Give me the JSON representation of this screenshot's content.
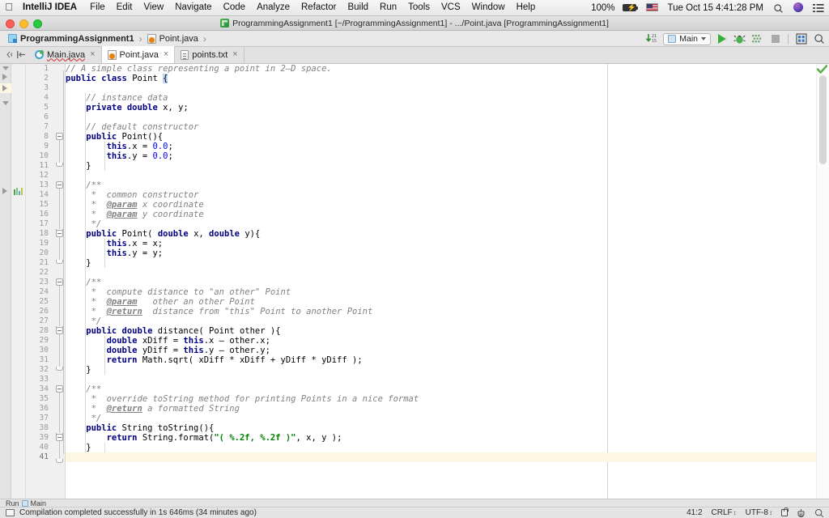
{
  "menubar": {
    "apple_icon": "apple-logo-icon",
    "app_name": "IntelliJ IDEA",
    "items": [
      "File",
      "Edit",
      "View",
      "Navigate",
      "Code",
      "Analyze",
      "Refactor",
      "Build",
      "Run",
      "Tools",
      "VCS",
      "Window",
      "Help"
    ],
    "battery_percent": "100%",
    "battery_icon": "battery-charging-icon",
    "input_source": "us-flag-icon",
    "clock": "Tue Oct 15  4:41:28 PM",
    "spotlight_icon": "search-icon",
    "siri_icon": "siri-icon",
    "control_center_icon": "list-menu-icon"
  },
  "titlebar": {
    "project_icon": "project-icon",
    "text": "ProgrammingAssignment1 [~/ProgrammingAssignment1] - .../Point.java [ProgrammingAssignment1]",
    "close_label": "close-window",
    "minimize_label": "minimize-window",
    "zoom_label": "zoom-window"
  },
  "navbar": {
    "breadcrumbs": [
      {
        "icon": "module-icon",
        "label": "ProgrammingAssignment1",
        "bold": true
      },
      {
        "icon": "java-file-icon",
        "label": "Point.java",
        "bold": false
      }
    ],
    "separator": "›",
    "update_icon": "update-project-icon",
    "run_config": {
      "icon": "run-config-icon",
      "label": "Main",
      "caret": "chevron-down-icon"
    },
    "run_icon": "run-icon",
    "debug_icon": "debug-icon",
    "coverage_icon": "run-with-coverage-icon",
    "stop_icon": "stop-icon",
    "layout_icon": "select-target-icon",
    "search_icon": "search-everywhere-icon"
  },
  "tabs": {
    "back_icon": "back-icon",
    "align_icon": "align-left-icon",
    "items": [
      {
        "icon": "class-icon",
        "label": "Main.java",
        "active": false,
        "error": true,
        "close": "×"
      },
      {
        "icon": "java-file-icon",
        "label": "Point.java",
        "active": true,
        "error": false,
        "close": "×"
      },
      {
        "icon": "text-file-icon",
        "label": "points.txt",
        "active": false,
        "error": false,
        "close": "×"
      }
    ]
  },
  "editor": {
    "inspection_icon": "inspections-ok-checkmark",
    "scrollbar": "vertical-scrollbar",
    "current_line": 41,
    "first_line": 1,
    "lines": [
      {
        "n": 1,
        "tokens": [
          {
            "t": "// A simple class representing a point in 2–D space.",
            "c": "cm"
          }
        ]
      },
      {
        "n": 2,
        "tokens": [
          {
            "t": "public class ",
            "c": "kw"
          },
          {
            "t": "Point ",
            "c": "pln"
          },
          {
            "t": "{",
            "c": "sel"
          }
        ]
      },
      {
        "n": 3,
        "tokens": []
      },
      {
        "n": 4,
        "tokens": [
          {
            "t": "    // instance data",
            "c": "cm"
          }
        ]
      },
      {
        "n": 5,
        "tokens": [
          {
            "t": "    private double ",
            "c": "kw"
          },
          {
            "t": "x, y;",
            "c": "pln"
          }
        ]
      },
      {
        "n": 6,
        "tokens": []
      },
      {
        "n": 7,
        "tokens": [
          {
            "t": "    // default constructor",
            "c": "cm"
          }
        ]
      },
      {
        "n": 8,
        "tokens": [
          {
            "t": "    public ",
            "c": "kw"
          },
          {
            "t": "Point(){",
            "c": "pln"
          }
        ]
      },
      {
        "n": 9,
        "tokens": [
          {
            "t": "        ",
            "c": "pln"
          },
          {
            "t": "this",
            "c": "kw"
          },
          {
            "t": ".x = ",
            "c": "pln"
          },
          {
            "t": "0.0",
            "c": "num"
          },
          {
            "t": ";",
            "c": "pln"
          }
        ]
      },
      {
        "n": 10,
        "tokens": [
          {
            "t": "        ",
            "c": "pln"
          },
          {
            "t": "this",
            "c": "kw"
          },
          {
            "t": ".y = ",
            "c": "pln"
          },
          {
            "t": "0.0",
            "c": "num"
          },
          {
            "t": ";",
            "c": "pln"
          }
        ]
      },
      {
        "n": 11,
        "tokens": [
          {
            "t": "    }",
            "c": "pln"
          }
        ]
      },
      {
        "n": 12,
        "tokens": []
      },
      {
        "n": 13,
        "tokens": [
          {
            "t": "    /**",
            "c": "doc"
          }
        ]
      },
      {
        "n": 14,
        "tokens": [
          {
            "t": "     *  common constructor",
            "c": "doc"
          }
        ]
      },
      {
        "n": 15,
        "tokens": [
          {
            "t": "     *  ",
            "c": "doc"
          },
          {
            "t": "@param",
            "c": "tag"
          },
          {
            "t": " x coordinate",
            "c": "doc"
          }
        ]
      },
      {
        "n": 16,
        "tokens": [
          {
            "t": "     *  ",
            "c": "doc"
          },
          {
            "t": "@param",
            "c": "tag"
          },
          {
            "t": " y coordinate",
            "c": "doc"
          }
        ]
      },
      {
        "n": 17,
        "tokens": [
          {
            "t": "     */",
            "c": "doc"
          }
        ]
      },
      {
        "n": 18,
        "tokens": [
          {
            "t": "    public ",
            "c": "kw"
          },
          {
            "t": "Point( ",
            "c": "pln"
          },
          {
            "t": "double ",
            "c": "kw"
          },
          {
            "t": "x, ",
            "c": "pln"
          },
          {
            "t": "double ",
            "c": "kw"
          },
          {
            "t": "y){",
            "c": "pln"
          }
        ]
      },
      {
        "n": 19,
        "tokens": [
          {
            "t": "        ",
            "c": "pln"
          },
          {
            "t": "this",
            "c": "kw"
          },
          {
            "t": ".x = x;",
            "c": "pln"
          }
        ]
      },
      {
        "n": 20,
        "tokens": [
          {
            "t": "        ",
            "c": "pln"
          },
          {
            "t": "this",
            "c": "kw"
          },
          {
            "t": ".y = y;",
            "c": "pln"
          }
        ]
      },
      {
        "n": 21,
        "tokens": [
          {
            "t": "    }",
            "c": "pln"
          }
        ]
      },
      {
        "n": 22,
        "tokens": []
      },
      {
        "n": 23,
        "tokens": [
          {
            "t": "    /**",
            "c": "doc"
          }
        ]
      },
      {
        "n": 24,
        "tokens": [
          {
            "t": "     *  compute distance to \"an other\" Point",
            "c": "doc"
          }
        ]
      },
      {
        "n": 25,
        "tokens": [
          {
            "t": "     *  ",
            "c": "doc"
          },
          {
            "t": "@param",
            "c": "tag"
          },
          {
            "t": "   other an other Point",
            "c": "doc"
          }
        ]
      },
      {
        "n": 26,
        "tokens": [
          {
            "t": "     *  ",
            "c": "doc"
          },
          {
            "t": "@return",
            "c": "tag"
          },
          {
            "t": "  distance from \"this\" Point to another Point",
            "c": "doc"
          }
        ]
      },
      {
        "n": 27,
        "tokens": [
          {
            "t": "     */",
            "c": "doc"
          }
        ]
      },
      {
        "n": 28,
        "tokens": [
          {
            "t": "    public double ",
            "c": "kw"
          },
          {
            "t": "distance( Point other ){",
            "c": "pln"
          }
        ]
      },
      {
        "n": 29,
        "tokens": [
          {
            "t": "        ",
            "c": "pln"
          },
          {
            "t": "double ",
            "c": "kw"
          },
          {
            "t": "xDiff = ",
            "c": "pln"
          },
          {
            "t": "this",
            "c": "kw"
          },
          {
            "t": ".x – other.x;",
            "c": "pln"
          }
        ]
      },
      {
        "n": 30,
        "tokens": [
          {
            "t": "        ",
            "c": "pln"
          },
          {
            "t": "double ",
            "c": "kw"
          },
          {
            "t": "yDiff = ",
            "c": "pln"
          },
          {
            "t": "this",
            "c": "kw"
          },
          {
            "t": ".y – other.y;",
            "c": "pln"
          }
        ]
      },
      {
        "n": 31,
        "tokens": [
          {
            "t": "        ",
            "c": "pln"
          },
          {
            "t": "return ",
            "c": "kw"
          },
          {
            "t": "Math.sqrt( xDiff * xDiff + yDiff * yDiff );",
            "c": "pln"
          }
        ]
      },
      {
        "n": 32,
        "tokens": [
          {
            "t": "    }",
            "c": "pln"
          }
        ]
      },
      {
        "n": 33,
        "tokens": []
      },
      {
        "n": 34,
        "tokens": [
          {
            "t": "    /**",
            "c": "doc"
          }
        ]
      },
      {
        "n": 35,
        "tokens": [
          {
            "t": "     *  override toString method for printing Points in a nice format",
            "c": "doc"
          }
        ]
      },
      {
        "n": 36,
        "tokens": [
          {
            "t": "     *  ",
            "c": "doc"
          },
          {
            "t": "@return",
            "c": "tag"
          },
          {
            "t": " a formatted String",
            "c": "doc"
          }
        ]
      },
      {
        "n": 37,
        "tokens": [
          {
            "t": "     */",
            "c": "doc"
          }
        ]
      },
      {
        "n": 38,
        "tokens": [
          {
            "t": "    public ",
            "c": "kw"
          },
          {
            "t": "String toString(){",
            "c": "pln"
          }
        ]
      },
      {
        "n": 39,
        "tokens": [
          {
            "t": "        ",
            "c": "pln"
          },
          {
            "t": "return ",
            "c": "kw"
          },
          {
            "t": "String.format(",
            "c": "pln"
          },
          {
            "t": "\"( %.2f, %.2f )\"",
            "c": "str"
          },
          {
            "t": ", x, y );",
            "c": "pln"
          }
        ]
      },
      {
        "n": 40,
        "tokens": [
          {
            "t": "    }",
            "c": "pln"
          }
        ]
      },
      {
        "n": 41,
        "tokens": [
          {
            "t": "}",
            "c": "sel"
          }
        ]
      }
    ]
  },
  "toolstrip": {
    "run_label": "Run",
    "run_config_icon": "run-config-icon",
    "run_config_label": "Main"
  },
  "statusbar": {
    "message_icon": "event-log-icon",
    "message": "Compilation completed successfully in 1s 646ms (34 minutes ago)",
    "caret_position": "41:2",
    "line_separator": "CRLF",
    "encoding": "UTF-8",
    "updown": "↕",
    "lock_icon": "read-only-lock-icon",
    "hector_icon": "inspection-level-icon",
    "search_icon": "search-icon"
  },
  "colors": {
    "keyword": "#000080",
    "comment": "#808080",
    "string": "#008000",
    "number": "#0000ff",
    "selection": "#b9d7f5",
    "current_line": "#fdf6e3",
    "accent_green": "#3aae3a"
  }
}
